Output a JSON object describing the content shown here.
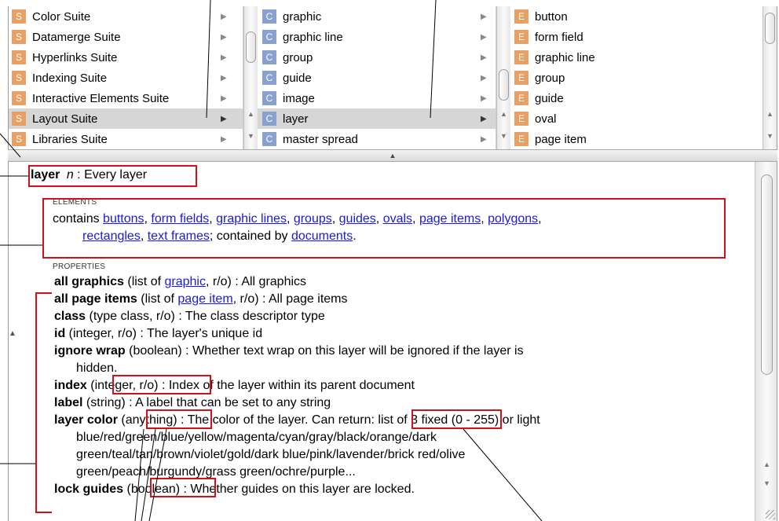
{
  "browser": {
    "suites": [
      {
        "badge": "S",
        "label": "Color Suite"
      },
      {
        "badge": "S",
        "label": "Datamerge Suite"
      },
      {
        "badge": "S",
        "label": "Hyperlinks Suite"
      },
      {
        "badge": "S",
        "label": "Indexing Suite"
      },
      {
        "badge": "S",
        "label": "Interactive Elements Suite"
      },
      {
        "badge": "S",
        "label": "Layout Suite",
        "selected": true
      },
      {
        "badge": "S",
        "label": "Libraries Suite"
      }
    ],
    "classes": [
      {
        "badge": "C",
        "label": "graphic"
      },
      {
        "badge": "C",
        "label": "graphic line"
      },
      {
        "badge": "C",
        "label": "group"
      },
      {
        "badge": "C",
        "label": "guide"
      },
      {
        "badge": "C",
        "label": "image"
      },
      {
        "badge": "C",
        "label": "layer",
        "selected": true
      },
      {
        "badge": "C",
        "label": "master spread"
      }
    ],
    "elements": [
      {
        "badge": "E",
        "label": "button"
      },
      {
        "badge": "E",
        "label": "form field"
      },
      {
        "badge": "E",
        "label": "graphic line"
      },
      {
        "badge": "E",
        "label": "group"
      },
      {
        "badge": "E",
        "label": "guide"
      },
      {
        "badge": "E",
        "label": "oval"
      },
      {
        "badge": "E",
        "label": "page item"
      }
    ]
  },
  "dictionary": {
    "term": "layer",
    "term_kind": "n",
    "term_desc": " : Every layer",
    "elements_heading": "ELEMENTS",
    "contains_prefix": "contains ",
    "element_links": [
      "buttons",
      "form fields",
      "graphic lines",
      "groups",
      "guides",
      "ovals",
      "page items",
      "polygons",
      "rectangles",
      "text frames"
    ],
    "contained_by_prefix": "; contained by ",
    "contained_by_link": "documents",
    "contained_by_suffix": ".",
    "properties_heading": "PROPERTIES",
    "properties": {
      "all_graphics": {
        "name": "all graphics",
        "pre": " (list of ",
        "link": "graphic",
        "post": ", r/o) : All graphics"
      },
      "all_page_items": {
        "name": "all page items",
        "pre": " (list of ",
        "link": "page item",
        "post": ", r/o) : All page items"
      },
      "class": {
        "name": "class",
        "rest": " (type class, r/o) : The class descriptor type"
      },
      "id": {
        "name": "id",
        "rest": " (integer, r/o) : The layer's unique id"
      },
      "ignore_wrap": {
        "name": "ignore wrap",
        "rest": " (boolean) : Whether text wrap on this layer will be ignored if the layer is",
        "cont": "hidden."
      },
      "index": {
        "name": "index",
        "type": "(integer, r/o)",
        "rest": " : Index of the layer within its parent document"
      },
      "label": {
        "name": "label",
        "rest": " (string) : A label that can be set to any string"
      },
      "layer_color": {
        "name": "layer color",
        "type": "(anything)",
        "mid": " : The color of the layer. ",
        "can_return": "Can return",
        "rest": ": list of 3 fixed (0 - 255) or light",
        "cont1": "blue/red/green/blue/yellow/magenta/cyan/gray/black/orange/dark",
        "cont2": "green/teal/tan/brown/violet/gold/dark blue/pink/lavender/brick red/olive",
        "cont3": "green/peach/burgundy/grass green/ochre/purple..."
      },
      "lock_guides": {
        "name": "lock guides",
        "type": "(boolean)",
        "rest": " : Whether guides on this layer are locked."
      }
    }
  },
  "annotation_color": "#d0101a"
}
